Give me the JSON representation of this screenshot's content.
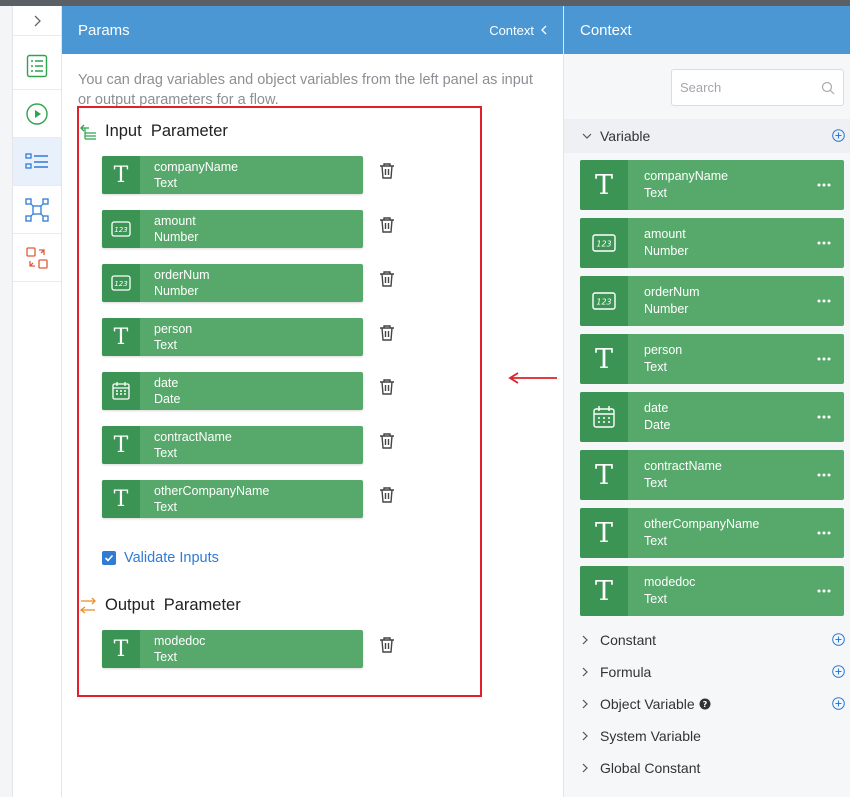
{
  "params_panel": {
    "title": "Params",
    "context_link": "Context",
    "hint": "You can drag variables and object variables from the left panel as input or output parameters for a flow.",
    "input_title": "Input  Parameter",
    "output_title": "Output  Parameter",
    "validate_label": "Validate Inputs",
    "validate_checked": true,
    "inputs": [
      {
        "name": "companyName",
        "type": "Text",
        "icon": "text-type-icon"
      },
      {
        "name": "amount",
        "type": "Number",
        "icon": "number-type-icon"
      },
      {
        "name": "orderNum",
        "type": "Number",
        "icon": "number-type-icon"
      },
      {
        "name": "person",
        "type": "Text",
        "icon": "text-type-icon"
      },
      {
        "name": "date",
        "type": "Date",
        "icon": "date-type-icon"
      },
      {
        "name": "contractName",
        "type": "Text",
        "icon": "text-type-icon"
      },
      {
        "name": "otherCompanyName",
        "type": "Text",
        "icon": "text-type-icon"
      }
    ],
    "outputs": [
      {
        "name": "modedoc",
        "type": "Text",
        "icon": "text-type-icon"
      }
    ]
  },
  "context_panel": {
    "title": "Context",
    "search_placeholder": "Search",
    "variable_group": "Variable",
    "variables": [
      {
        "name": "companyName",
        "type": "Text",
        "icon": "text-type-icon"
      },
      {
        "name": "amount",
        "type": "Number",
        "icon": "number-type-icon"
      },
      {
        "name": "orderNum",
        "type": "Number",
        "icon": "number-type-icon"
      },
      {
        "name": "person",
        "type": "Text",
        "icon": "text-type-icon"
      },
      {
        "name": "date",
        "type": "Date",
        "icon": "date-type-icon"
      },
      {
        "name": "contractName",
        "type": "Text",
        "icon": "text-type-icon"
      },
      {
        "name": "otherCompanyName",
        "type": "Text",
        "icon": "text-type-icon"
      },
      {
        "name": "modedoc",
        "type": "Text",
        "icon": "text-type-icon"
      }
    ],
    "groups": [
      "Constant",
      "Formula",
      "Object Variable",
      "System Variable",
      "Global Constant"
    ]
  },
  "colors": {
    "header_blue": "#4a97d4",
    "card_green": "#56a96a",
    "card_icon_green": "#3c9454",
    "highlight_red": "#e0202a",
    "link_blue": "#2f7bd6"
  }
}
